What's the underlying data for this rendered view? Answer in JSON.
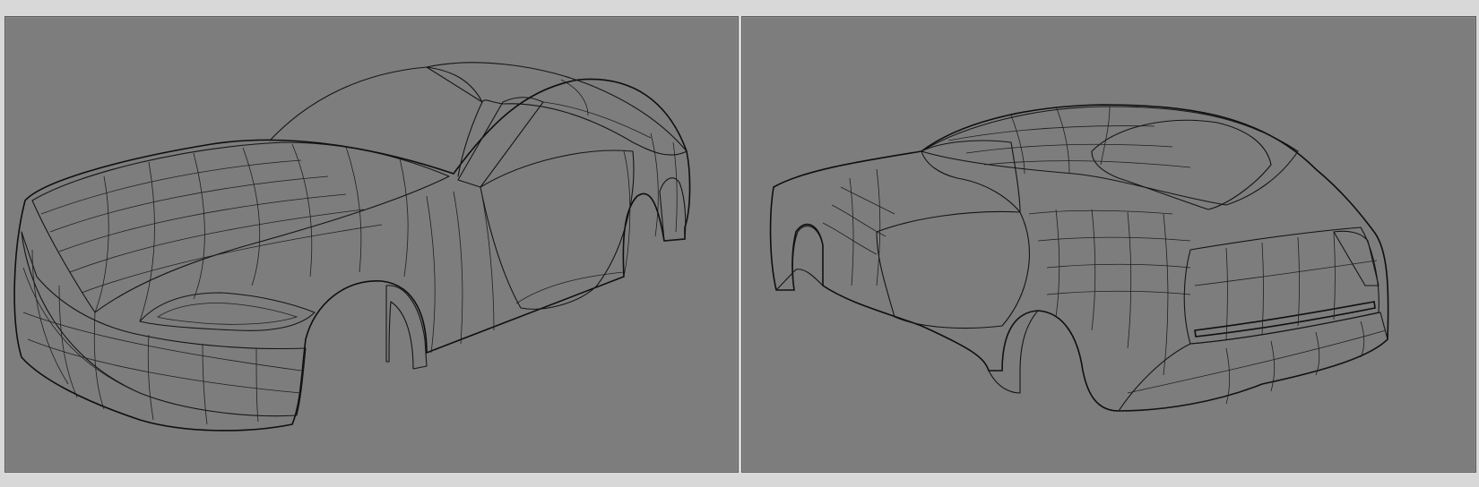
{
  "viewports": [
    {
      "id": "front-perspective",
      "model": "car-body-wireframe-front-view"
    },
    {
      "id": "rear-perspective",
      "model": "car-body-wireframe-rear-view"
    }
  ],
  "colors": {
    "background": "#d8d8d8",
    "viewport_bg": "#7d7d7d",
    "surface_light": "#a3a3a3",
    "surface_mid": "#8c8c8c",
    "surface_dark": "#4a4a4a",
    "wire": "#151515"
  }
}
